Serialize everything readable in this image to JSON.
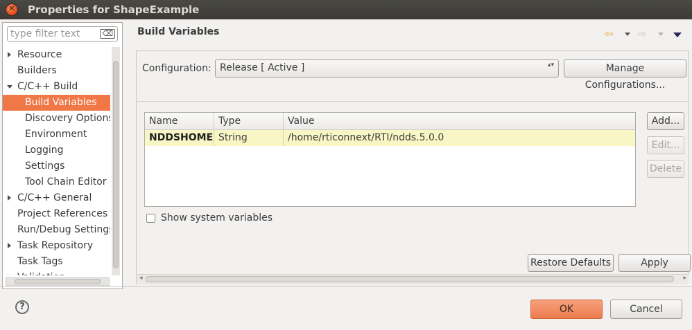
{
  "window": {
    "title": "Properties for ShapeExample",
    "close_glyph": "×"
  },
  "filter": {
    "placeholder": "type filter text",
    "clear_glyph": "⌫"
  },
  "tree": {
    "items": [
      {
        "label": "Resource",
        "indent": 0,
        "expander": "collapsed",
        "selected": false
      },
      {
        "label": "Builders",
        "indent": 0,
        "expander": "none",
        "selected": false
      },
      {
        "label": "C/C++ Build",
        "indent": 0,
        "expander": "expanded",
        "selected": false
      },
      {
        "label": "Build Variables",
        "indent": 1,
        "expander": "none",
        "selected": true
      },
      {
        "label": "Discovery Options",
        "indent": 1,
        "expander": "none",
        "selected": false
      },
      {
        "label": "Environment",
        "indent": 1,
        "expander": "none",
        "selected": false
      },
      {
        "label": "Logging",
        "indent": 1,
        "expander": "none",
        "selected": false
      },
      {
        "label": "Settings",
        "indent": 1,
        "expander": "none",
        "selected": false
      },
      {
        "label": "Tool Chain Editor",
        "indent": 1,
        "expander": "none",
        "selected": false
      },
      {
        "label": "C/C++ General",
        "indent": 0,
        "expander": "collapsed",
        "selected": false
      },
      {
        "label": "Project References",
        "indent": 0,
        "expander": "none",
        "selected": false
      },
      {
        "label": "Run/Debug Settings",
        "indent": 0,
        "expander": "none",
        "selected": false
      },
      {
        "label": "Task Repository",
        "indent": 0,
        "expander": "collapsed",
        "selected": false
      },
      {
        "label": "Task Tags",
        "indent": 0,
        "expander": "none",
        "selected": false
      },
      {
        "label": "Validation",
        "indent": 0,
        "expander": "collapsed",
        "selected": false
      }
    ]
  },
  "page": {
    "title": "Build Variables",
    "nav": {
      "back_glyph": "⇦",
      "forward_glyph": "⇨"
    }
  },
  "config": {
    "label": "Configuration:",
    "value": "Release  [ Active ]",
    "spin_glyph": "▴▾",
    "manage_label": "Manage Configurations..."
  },
  "table": {
    "columns": [
      "Name",
      "Type",
      "Value"
    ],
    "rows": [
      {
        "name": "NDDSHOME",
        "type": "String",
        "value": "/home/rticonnext/RTI/ndds.5.0.0"
      }
    ]
  },
  "buttons": {
    "add": "Add...",
    "edit": "Edit...",
    "delete": "Delete",
    "restore": "Restore Defaults",
    "apply": "Apply"
  },
  "show_system": {
    "label": "Show system variables",
    "checked": false
  },
  "footer": {
    "help_glyph": "?",
    "ok": "OK",
    "cancel": "Cancel"
  },
  "colors": {
    "selection": "#f07746",
    "row_highlight": "#f8f6c4",
    "ok_button": "#ec7b4f"
  }
}
